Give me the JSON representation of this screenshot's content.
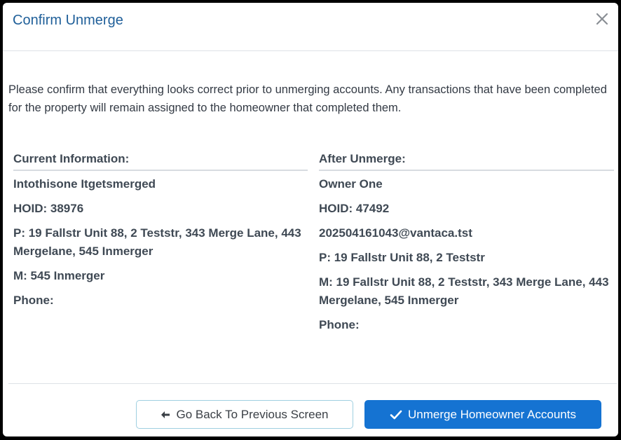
{
  "modal": {
    "title": "Confirm Unmerge",
    "close_icon": "close-icon",
    "intro_text": "Please confirm that everything looks correct prior to unmerging accounts. Any transactions that have been completed for the property will remain assigned to the homeowner that completed them."
  },
  "current": {
    "heading": "Current Information:",
    "name": "Intothisone Itgetsmerged",
    "hoid": "HOID: 38976",
    "property": "P: 19 Fallstr Unit 88, 2 Teststr, 343 Merge Lane, 443 Mergelane, 545 Inmerger",
    "mailing": "M: 545 Inmerger",
    "phone": "Phone:"
  },
  "after": {
    "heading": "After Unmerge:",
    "name": "Owner One",
    "hoid": "HOID: 47492",
    "email": "202504161043@vantaca.tst",
    "property": "P: 19 Fallstr Unit 88, 2 Teststr",
    "mailing": "M: 19 Fallstr Unit 88, 2 Teststr, 343 Merge Lane, 443 Mergelane, 545 Inmerger",
    "phone": "Phone:"
  },
  "footer": {
    "back_label": "Go Back To Previous Screen",
    "back_icon": "arrow-left-icon",
    "unmerge_label": "Unmerge Homeowner Accounts",
    "unmerge_icon": "check-icon"
  },
  "colors": {
    "title": "#1f5f99",
    "primary_button": "#1573d2",
    "secondary_border": "#9fcfe0"
  }
}
